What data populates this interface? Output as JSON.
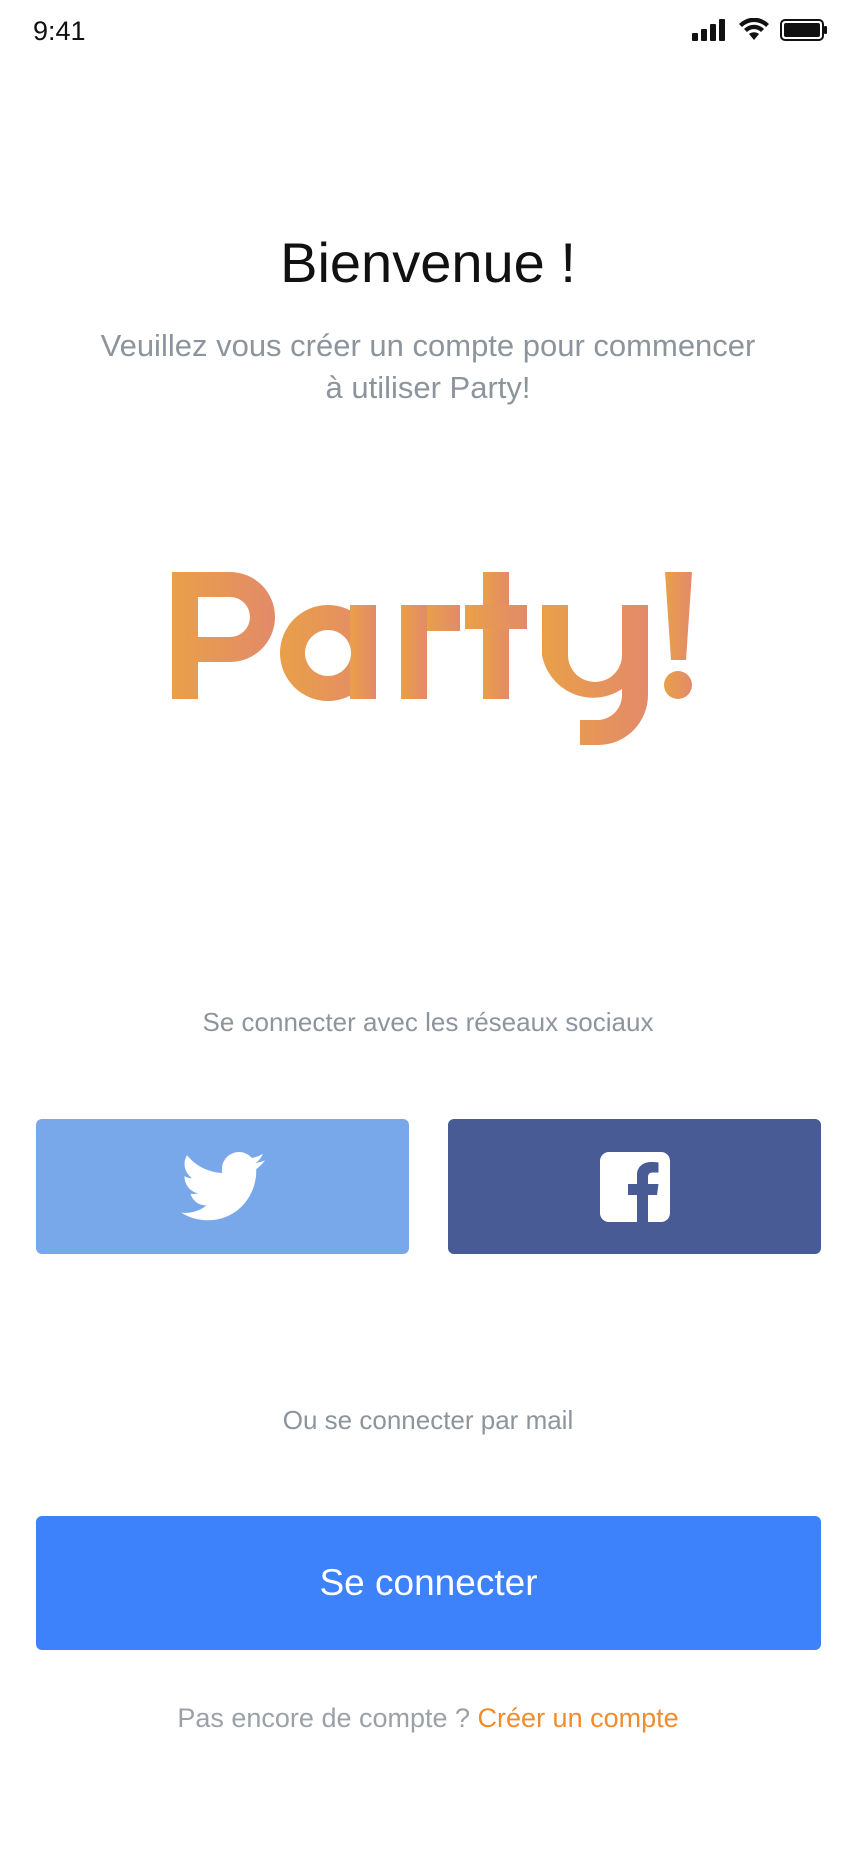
{
  "status_bar": {
    "time": "9:41",
    "icons": [
      "signal-icon",
      "wifi-icon",
      "battery-icon"
    ]
  },
  "welcome": {
    "title": "Bienvenue !",
    "subtitle_line1": "Veuillez vous créer un compte pour commencer",
    "subtitle_line2": "à utiliser Party!"
  },
  "logo": {
    "text": "Party!",
    "gradient_start": "#e8a048",
    "gradient_end": "#e38a6a"
  },
  "social": {
    "caption": "Se connecter avec les réseaux sociaux",
    "buttons": [
      {
        "icon": "twitter-icon",
        "color": "#78a8e9"
      },
      {
        "icon": "facebook-icon",
        "color": "#485b95"
      }
    ]
  },
  "mail": {
    "caption": "Ou se connecter par mail",
    "login_label": "Se connecter",
    "login_color": "#3e82fb"
  },
  "signup": {
    "prompt": "Pas encore de compte ? ",
    "link_label": "Créer un compte",
    "link_color": "#f08c2c"
  }
}
